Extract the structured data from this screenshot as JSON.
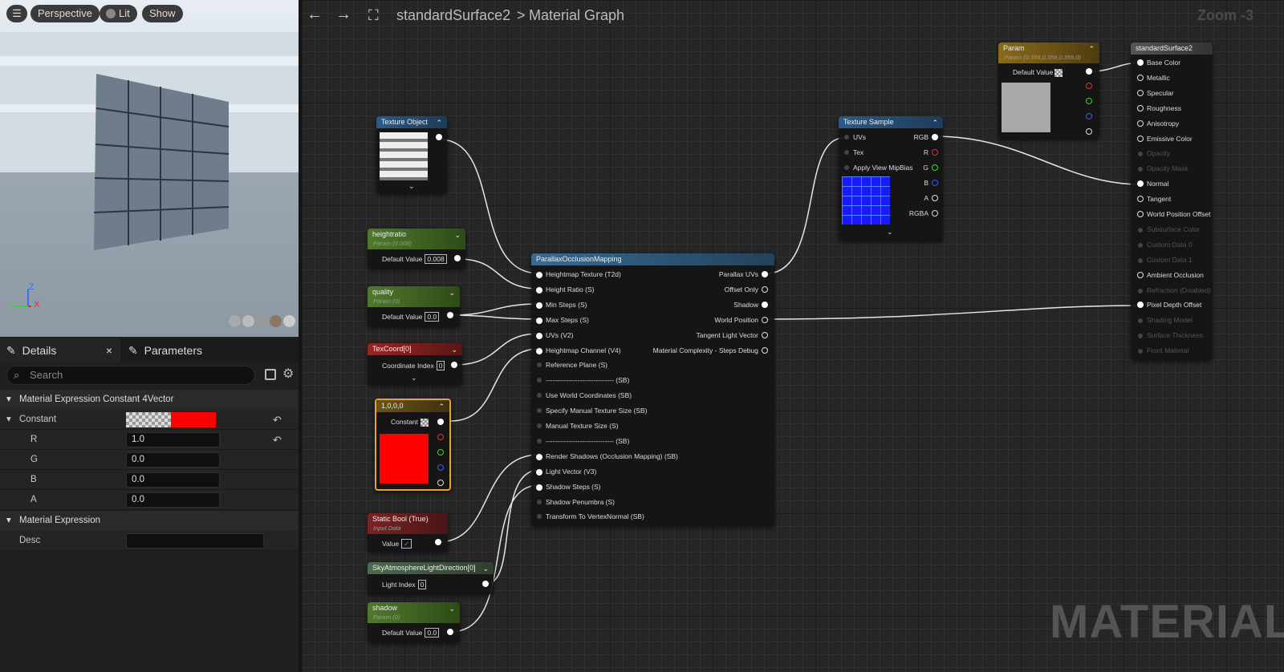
{
  "viewport": {
    "perspective": "Perspective",
    "lit": "Lit",
    "show": "Show",
    "axis_z": "Z",
    "axis_x": "X"
  },
  "tabs": {
    "details": "Details",
    "parameters": "Parameters",
    "close": "×"
  },
  "search": {
    "placeholder": "Search"
  },
  "details": {
    "section1": "Material Expression Constant 4Vector",
    "constant_label": "Constant",
    "r_label": "R",
    "r": "1.0",
    "g_label": "G",
    "g": "0.0",
    "b_label": "B",
    "b": "0.0",
    "a_label": "A",
    "a": "0.0",
    "section2": "Material Expression",
    "desc_label": "Desc",
    "desc": ""
  },
  "graph": {
    "crumb1": "standardSurface2",
    "crumb_sep": ">",
    "crumb2": "Material Graph",
    "zoom": "Zoom -3",
    "watermark": "MATERIAL"
  },
  "nodes": {
    "texobj": {
      "title": "Texture Object"
    },
    "height": {
      "title": "heightratio",
      "sub": "Param (0.008)",
      "label": "Default Value",
      "value": "0.008"
    },
    "quality": {
      "title": "quality",
      "sub": "Param (0)",
      "label": "Default Value",
      "value": "0.0"
    },
    "texcoord": {
      "title": "TexCoord[0]",
      "label": "Coordinate Index",
      "value": "0"
    },
    "vec": {
      "title": "1,0,0,0",
      "label": "Constant"
    },
    "staticbool": {
      "title": "Static Bool (True)",
      "sub": "Input Data",
      "label": "Value",
      "check": "✓"
    },
    "sky": {
      "title": "SkyAtmosphereLightDirection[0]",
      "label": "Light Index",
      "value": "0"
    },
    "shadow": {
      "title": "shadow",
      "sub": "Param (0)",
      "label": "Default Value",
      "value": "0.0"
    },
    "pom": {
      "title": "ParallaxOcclusionMapping",
      "inputs": [
        "Heightmap Texture (T2d)",
        "Height Ratio (S)",
        "Min Steps (S)",
        "Max Steps (S)",
        "UVs (V2)",
        "Heightmap Channel (V4)",
        "Reference Plane (S)",
        "------------------------------ (SB)",
        "Use World Coordinates (SB)",
        "Specify Manual Texture Size (SB)",
        "Manual Texture Size (S)",
        "------------------------------ (SB)",
        "Render Shadows (Occlusion Mapping) (SB)",
        "Light Vector (V3)",
        "Shadow Steps (S)",
        "Shadow Penumbra (S)",
        "Transform To VertexNormal (SB)"
      ],
      "outputs": [
        "Parallax UVs",
        "Offset Only",
        "Shadow",
        "World Position",
        "Tangent Light Vector",
        "Material Complexity - Steps Debug"
      ]
    },
    "texsample": {
      "title": "Texture Sample",
      "in1": "UVs",
      "in2": "Tex",
      "in3": "Apply View MipBias",
      "out1": "RGB",
      "out2": "R",
      "out3": "G",
      "out4": "B",
      "out5": "A",
      "out6": "RGBA"
    },
    "param": {
      "title": "Param",
      "sub": "Param (0.359,0.359,0.359,0)",
      "label": "Default Value"
    },
    "surface": {
      "title": "standardSurface2",
      "inputs": [
        "Base Color",
        "Metallic",
        "Specular",
        "Roughness",
        "Anisotropy",
        "Emissive Color",
        "Opacity",
        "Opacity Mask",
        "Normal",
        "Tangent",
        "World Position Offset",
        "Subsurface Color",
        "Custom Data 0",
        "Custom Data 1",
        "Ambient Occlusion",
        "Refraction (Disabled)",
        "Pixel Depth Offset",
        "Shading Model",
        "Surface Thickness",
        "Front Material"
      ]
    }
  },
  "colors": {
    "accent_red": "#ff0000",
    "selection": "#e8a32a"
  }
}
